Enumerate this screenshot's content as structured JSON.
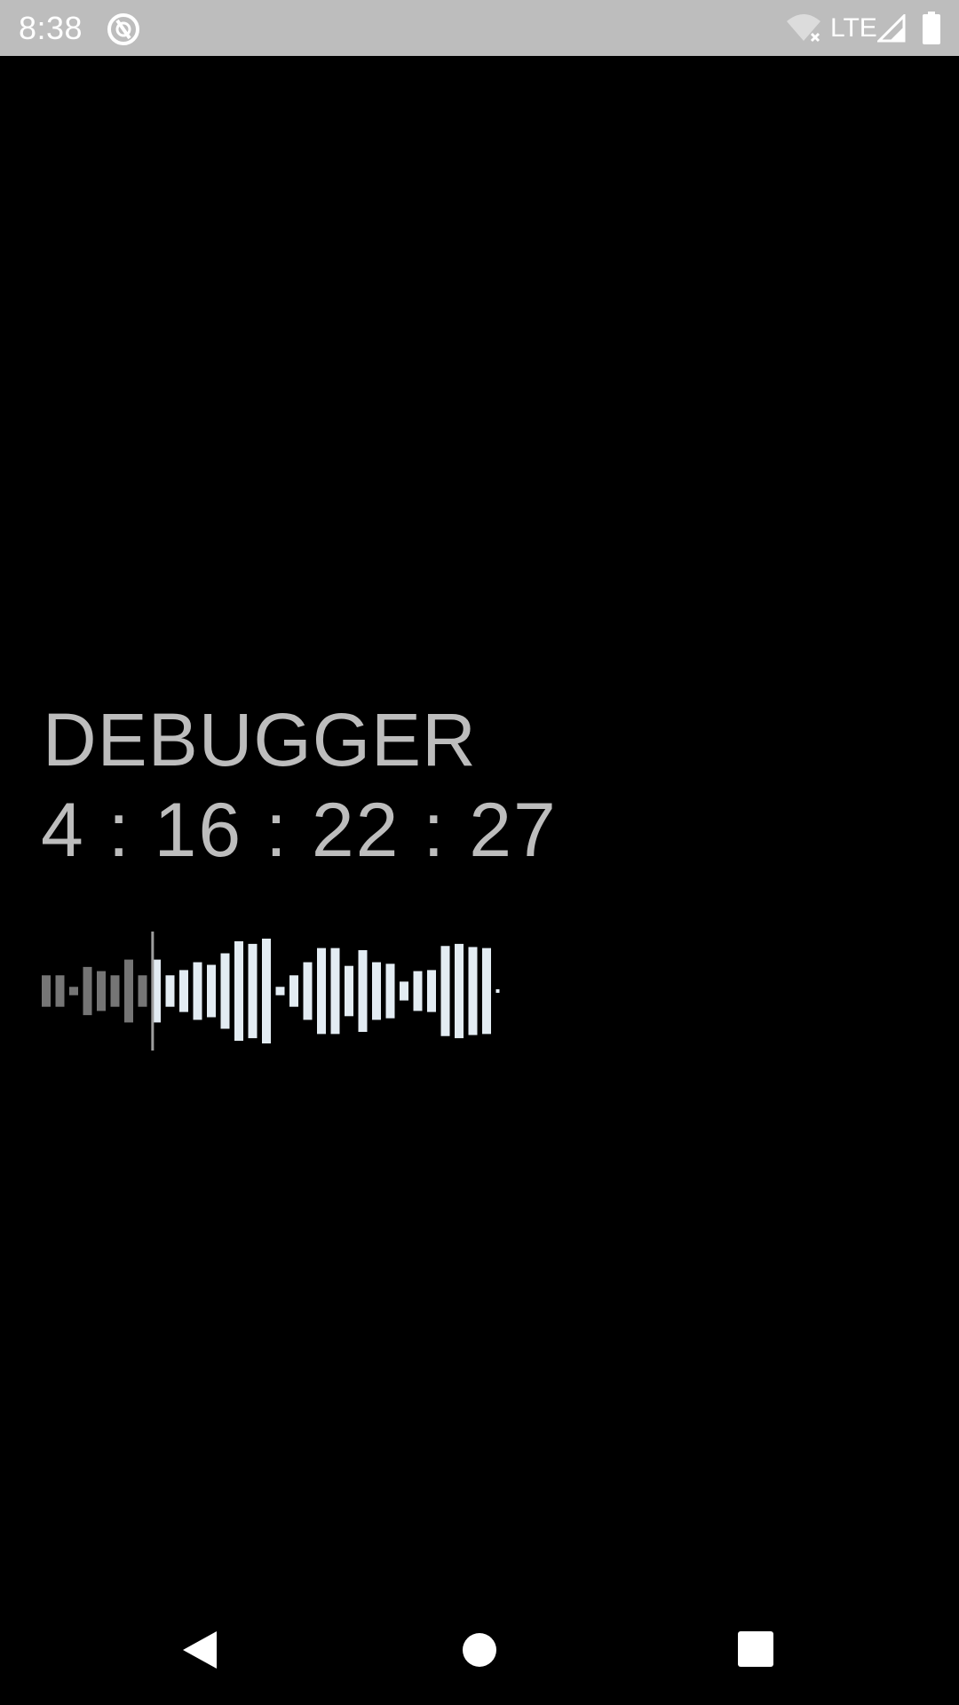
{
  "status_bar": {
    "time": "8:38",
    "network": "LTE",
    "icons": [
      "app-notification-icon",
      "wifi-off-icon",
      "signal-icon",
      "battery-icon"
    ]
  },
  "main": {
    "title": "DEBUGGER",
    "timer": "4 : 16 : 22 : 27",
    "waveform": {
      "played_color": "#757575",
      "unplayed_color": "#e3ecf3",
      "playhead_color": "#9e9e9e",
      "bar_levels": [
        0.3,
        0.3,
        0.08,
        0.46,
        0.38,
        0.3,
        0.6,
        0.3,
        0.6,
        0.3,
        0.4,
        0.55,
        0.5,
        0.72,
        0.95,
        0.9,
        1.0,
        0.08,
        0.3,
        0.55,
        0.82,
        0.82,
        0.48,
        0.78,
        0.55,
        0.52,
        0.18,
        0.38,
        0.4,
        0.86,
        0.9,
        0.84,
        0.82,
        0.03
      ],
      "played_fraction": 0.24
    }
  },
  "nav_bar": {
    "icons": [
      "back-icon",
      "home-icon",
      "recents-icon"
    ]
  }
}
